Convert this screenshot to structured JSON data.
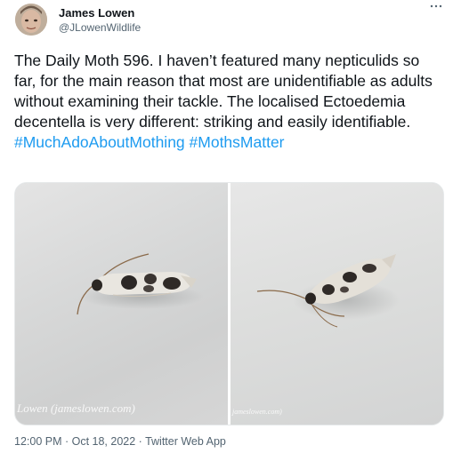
{
  "author": {
    "name": "James Lowen",
    "handle": "@JLowenWildlife"
  },
  "tweet": {
    "text": "The Daily Moth 596. I haven’t featured many nepticulids so far, for the main reason that most are unidentifiable as adults without examining their tackle. The localised Ectoedemia decentella is very different: striking and easily identifiable.",
    "hashtags": [
      "#MuchAdoAboutMothing",
      "#MothsMatter"
    ]
  },
  "media": {
    "photos": [
      {
        "subject": "Ectoedemia decentella moth, lateral view",
        "watermark": "Lowen (jameslowen.com)"
      },
      {
        "subject": "Ectoedemia decentella moth, front-oblique view",
        "watermark": "jameslowen.com)"
      }
    ]
  },
  "meta": {
    "timestamp": "12:00 PM · Oct 18, 2022 · Twitter Web App"
  },
  "icons": {
    "more": "more-dots-icon"
  }
}
